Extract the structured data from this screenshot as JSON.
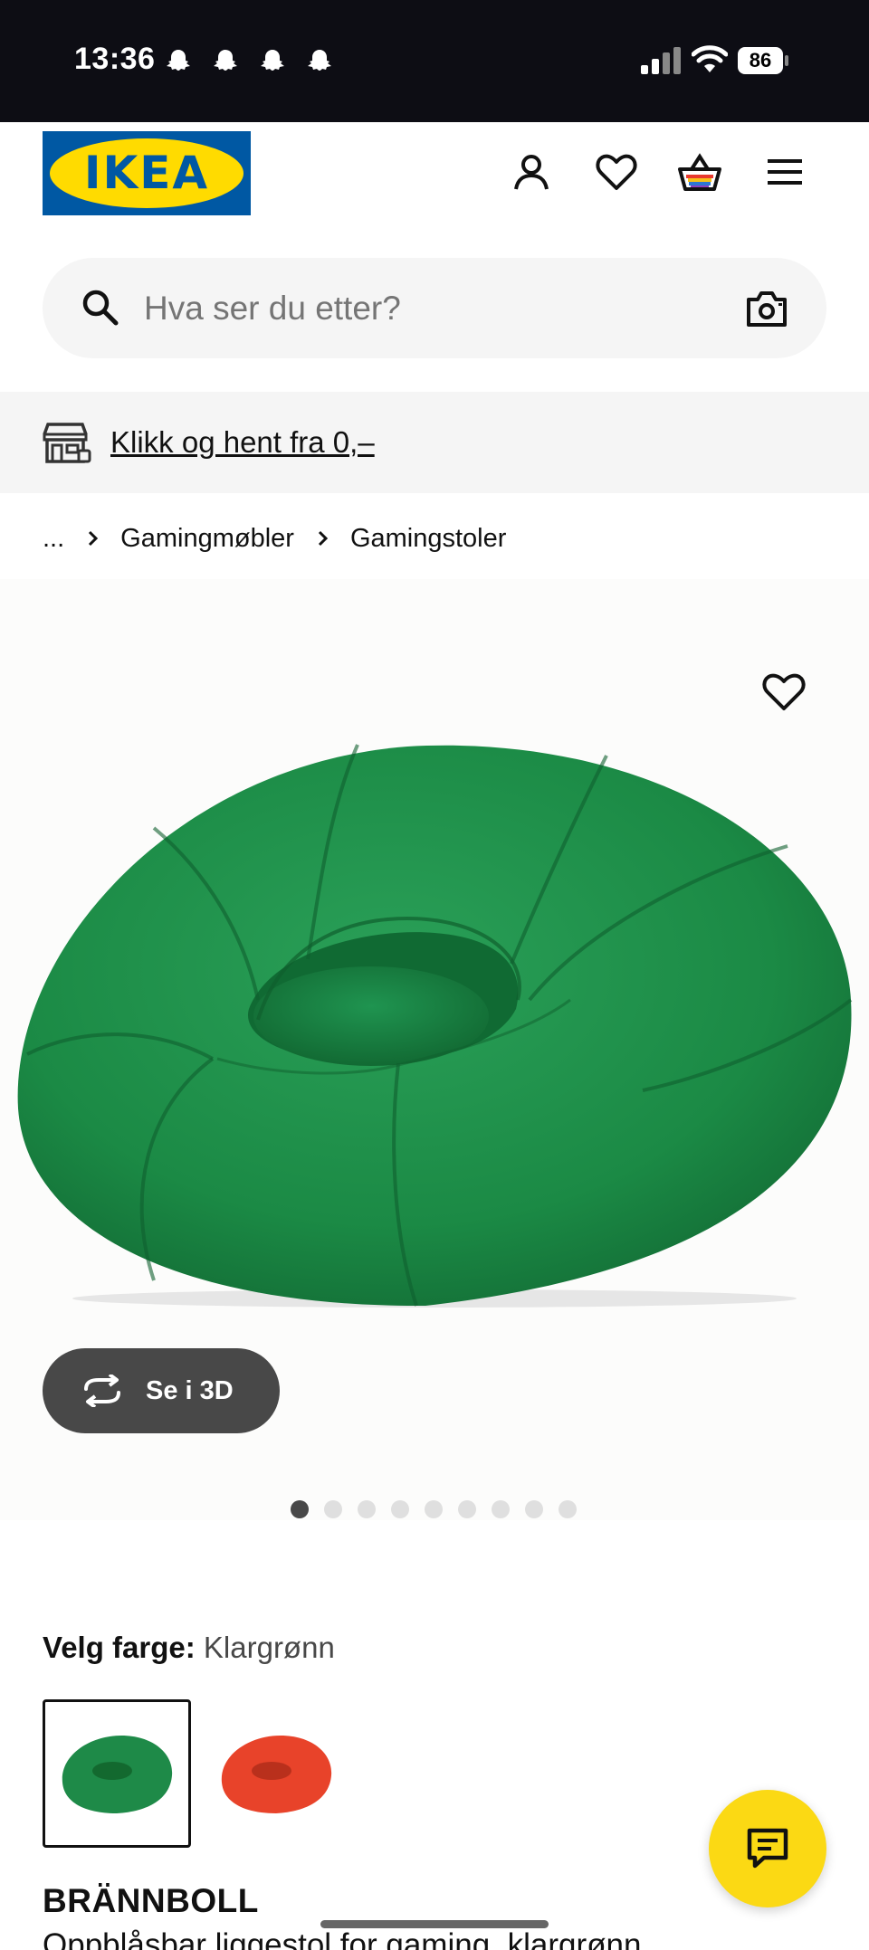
{
  "status_bar": {
    "time": "13:36",
    "battery": "86",
    "notification_icons": [
      "snapchat-icon",
      "snapchat-icon",
      "snapchat-icon",
      "snapchat-icon"
    ]
  },
  "header": {
    "logo_text": "IKEA",
    "brand_colors": {
      "blue": "#0058a3",
      "yellow": "#ffdb00"
    },
    "icons": [
      "account-icon",
      "heart-icon",
      "cart-icon",
      "menu-icon"
    ]
  },
  "search": {
    "placeholder": "Hva ser du etter?"
  },
  "promo": {
    "text": "Klikk og hent fra 0,–"
  },
  "breadcrumb": {
    "ellipsis": "...",
    "items": [
      "Gamingmøbler",
      "Gamingstoler"
    ]
  },
  "gallery": {
    "view_3d_label": "Se i 3D",
    "image_count": 9,
    "active_index": 0,
    "product_color": "#1e8a48"
  },
  "color_selector": {
    "label": "Velg farge:",
    "selected": "Klargrønn",
    "options": [
      {
        "color": "#1e8a48",
        "selected": true
      },
      {
        "color": "#e8432a",
        "selected": false
      }
    ]
  },
  "product": {
    "name": "BRÄNNBOLL",
    "description": "Oppblåsbar liggestol for gaming, klargrønn"
  },
  "chat": {
    "icon": "chat-icon",
    "color": "#fbd914"
  }
}
